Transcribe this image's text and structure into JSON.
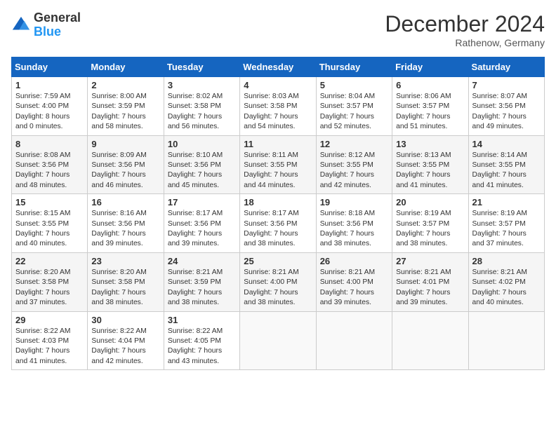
{
  "header": {
    "logo_general": "General",
    "logo_blue": "Blue",
    "month_title": "December 2024",
    "subtitle": "Rathenow, Germany"
  },
  "columns": [
    "Sunday",
    "Monday",
    "Tuesday",
    "Wednesday",
    "Thursday",
    "Friday",
    "Saturday"
  ],
  "weeks": [
    [
      {
        "day": "1",
        "info": "Sunrise: 7:59 AM\nSunset: 4:00 PM\nDaylight: 8 hours\nand 0 minutes."
      },
      {
        "day": "2",
        "info": "Sunrise: 8:00 AM\nSunset: 3:59 PM\nDaylight: 7 hours\nand 58 minutes."
      },
      {
        "day": "3",
        "info": "Sunrise: 8:02 AM\nSunset: 3:58 PM\nDaylight: 7 hours\nand 56 minutes."
      },
      {
        "day": "4",
        "info": "Sunrise: 8:03 AM\nSunset: 3:58 PM\nDaylight: 7 hours\nand 54 minutes."
      },
      {
        "day": "5",
        "info": "Sunrise: 8:04 AM\nSunset: 3:57 PM\nDaylight: 7 hours\nand 52 minutes."
      },
      {
        "day": "6",
        "info": "Sunrise: 8:06 AM\nSunset: 3:57 PM\nDaylight: 7 hours\nand 51 minutes."
      },
      {
        "day": "7",
        "info": "Sunrise: 8:07 AM\nSunset: 3:56 PM\nDaylight: 7 hours\nand 49 minutes."
      }
    ],
    [
      {
        "day": "8",
        "info": "Sunrise: 8:08 AM\nSunset: 3:56 PM\nDaylight: 7 hours\nand 48 minutes."
      },
      {
        "day": "9",
        "info": "Sunrise: 8:09 AM\nSunset: 3:56 PM\nDaylight: 7 hours\nand 46 minutes."
      },
      {
        "day": "10",
        "info": "Sunrise: 8:10 AM\nSunset: 3:56 PM\nDaylight: 7 hours\nand 45 minutes."
      },
      {
        "day": "11",
        "info": "Sunrise: 8:11 AM\nSunset: 3:55 PM\nDaylight: 7 hours\nand 44 minutes."
      },
      {
        "day": "12",
        "info": "Sunrise: 8:12 AM\nSunset: 3:55 PM\nDaylight: 7 hours\nand 42 minutes."
      },
      {
        "day": "13",
        "info": "Sunrise: 8:13 AM\nSunset: 3:55 PM\nDaylight: 7 hours\nand 41 minutes."
      },
      {
        "day": "14",
        "info": "Sunrise: 8:14 AM\nSunset: 3:55 PM\nDaylight: 7 hours\nand 41 minutes."
      }
    ],
    [
      {
        "day": "15",
        "info": "Sunrise: 8:15 AM\nSunset: 3:55 PM\nDaylight: 7 hours\nand 40 minutes."
      },
      {
        "day": "16",
        "info": "Sunrise: 8:16 AM\nSunset: 3:56 PM\nDaylight: 7 hours\nand 39 minutes."
      },
      {
        "day": "17",
        "info": "Sunrise: 8:17 AM\nSunset: 3:56 PM\nDaylight: 7 hours\nand 39 minutes."
      },
      {
        "day": "18",
        "info": "Sunrise: 8:17 AM\nSunset: 3:56 PM\nDaylight: 7 hours\nand 38 minutes."
      },
      {
        "day": "19",
        "info": "Sunrise: 8:18 AM\nSunset: 3:56 PM\nDaylight: 7 hours\nand 38 minutes."
      },
      {
        "day": "20",
        "info": "Sunrise: 8:19 AM\nSunset: 3:57 PM\nDaylight: 7 hours\nand 38 minutes."
      },
      {
        "day": "21",
        "info": "Sunrise: 8:19 AM\nSunset: 3:57 PM\nDaylight: 7 hours\nand 37 minutes."
      }
    ],
    [
      {
        "day": "22",
        "info": "Sunrise: 8:20 AM\nSunset: 3:58 PM\nDaylight: 7 hours\nand 37 minutes."
      },
      {
        "day": "23",
        "info": "Sunrise: 8:20 AM\nSunset: 3:58 PM\nDaylight: 7 hours\nand 38 minutes."
      },
      {
        "day": "24",
        "info": "Sunrise: 8:21 AM\nSunset: 3:59 PM\nDaylight: 7 hours\nand 38 minutes."
      },
      {
        "day": "25",
        "info": "Sunrise: 8:21 AM\nSunset: 4:00 PM\nDaylight: 7 hours\nand 38 minutes."
      },
      {
        "day": "26",
        "info": "Sunrise: 8:21 AM\nSunset: 4:00 PM\nDaylight: 7 hours\nand 39 minutes."
      },
      {
        "day": "27",
        "info": "Sunrise: 8:21 AM\nSunset: 4:01 PM\nDaylight: 7 hours\nand 39 minutes."
      },
      {
        "day": "28",
        "info": "Sunrise: 8:21 AM\nSunset: 4:02 PM\nDaylight: 7 hours\nand 40 minutes."
      }
    ],
    [
      {
        "day": "29",
        "info": "Sunrise: 8:22 AM\nSunset: 4:03 PM\nDaylight: 7 hours\nand 41 minutes."
      },
      {
        "day": "30",
        "info": "Sunrise: 8:22 AM\nSunset: 4:04 PM\nDaylight: 7 hours\nand 42 minutes."
      },
      {
        "day": "31",
        "info": "Sunrise: 8:22 AM\nSunset: 4:05 PM\nDaylight: 7 hours\nand 43 minutes."
      },
      null,
      null,
      null,
      null
    ]
  ]
}
